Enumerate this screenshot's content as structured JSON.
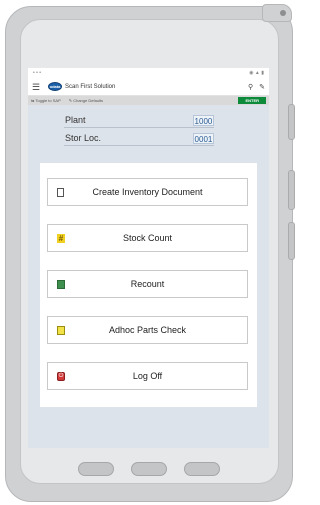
{
  "statusbar": {
    "left": "• • •",
    "right": "◉ ▲ ▮"
  },
  "appbar": {
    "title": "Scan First Solution",
    "logo_text": "odata",
    "menu_icon": "hamburger-menu-icon",
    "search_icon": "search-icon",
    "edit_icon": "pencil-icon"
  },
  "toolbar": {
    "toggle_label": "Toggle to SAP",
    "change_label": "Change Defaults",
    "enter_label": "ENTER"
  },
  "fields": [
    {
      "label": "Plant",
      "value": "1000"
    },
    {
      "label": "Stor Loc.",
      "value": "0001"
    }
  ],
  "menu": [
    {
      "label": "Create Inventory Document",
      "icon": "document-icon"
    },
    {
      "label": "Stock Count",
      "icon": "grid-count-icon"
    },
    {
      "label": "Recount",
      "icon": "clipboard-icon"
    },
    {
      "label": "Adhoc Parts Check",
      "icon": "note-icon"
    },
    {
      "label": "Log Off",
      "icon": "power-off-icon"
    }
  ],
  "colors": {
    "enter_button": "#0e8a3b",
    "screen_background": "#dde3ea",
    "field_value": "#2a5d94"
  }
}
